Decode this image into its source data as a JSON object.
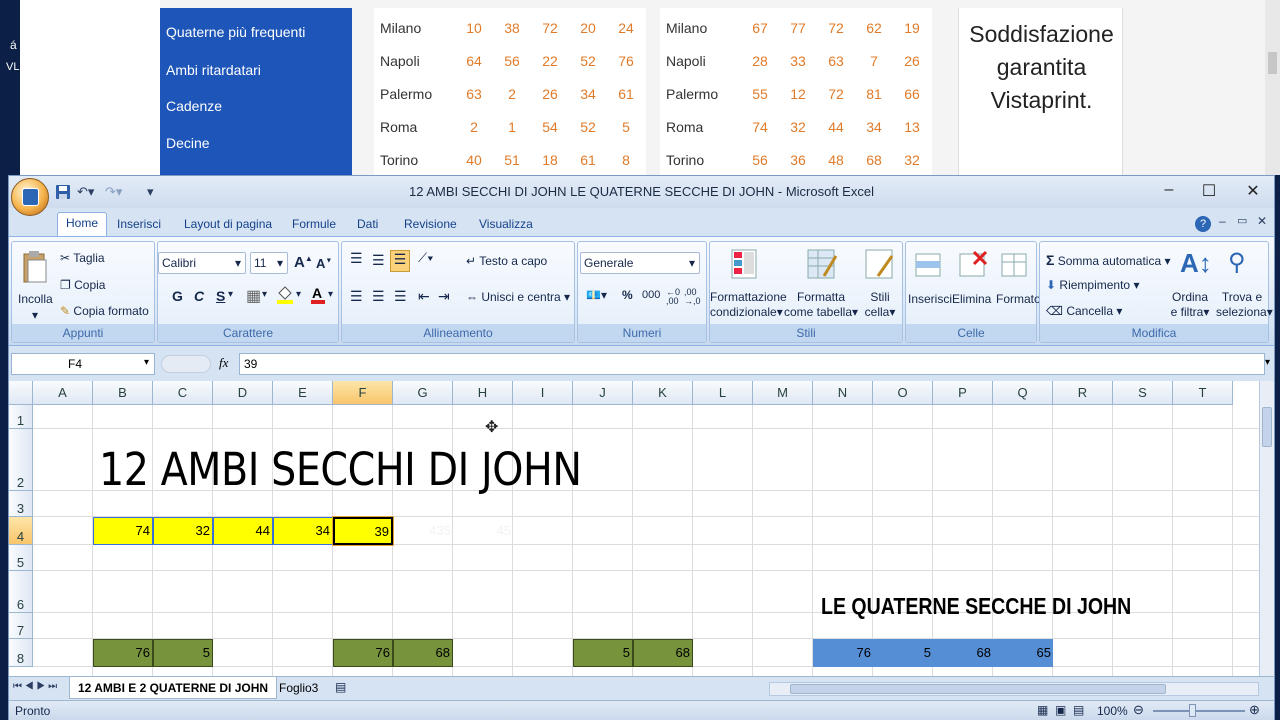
{
  "background_page": {
    "menu_items": [
      "Quaterne più frequenti",
      "Ambi ritardatari",
      "Cadenze",
      "Decine"
    ],
    "table1": [
      {
        "city": "Milano",
        "nums": [
          "10",
          "38",
          "72",
          "20",
          "24"
        ]
      },
      {
        "city": "Napoli",
        "nums": [
          "64",
          "56",
          "22",
          "52",
          "76"
        ]
      },
      {
        "city": "Palermo",
        "nums": [
          "63",
          "2",
          "26",
          "34",
          "61"
        ]
      },
      {
        "city": "Roma",
        "nums": [
          "2",
          "1",
          "54",
          "52",
          "5"
        ]
      },
      {
        "city": "Torino",
        "nums": [
          "40",
          "51",
          "18",
          "61",
          "8"
        ]
      }
    ],
    "table2": [
      {
        "city": "Milano",
        "nums": [
          "67",
          "77",
          "72",
          "62",
          "19"
        ]
      },
      {
        "city": "Napoli",
        "nums": [
          "28",
          "33",
          "63",
          "7",
          "26"
        ]
      },
      {
        "city": "Palermo",
        "nums": [
          "55",
          "12",
          "72",
          "81",
          "66"
        ]
      },
      {
        "city": "Roma",
        "nums": [
          "74",
          "32",
          "44",
          "34",
          "13"
        ]
      },
      {
        "city": "Torino",
        "nums": [
          "56",
          "36",
          "48",
          "68",
          "32"
        ]
      }
    ],
    "ad_text": [
      "Soddisfazione",
      "garantita",
      "Vistaprint."
    ],
    "side_letters": [
      "á",
      "VL"
    ]
  },
  "window": {
    "title": "12 AMBI SECCHI DI JOHN LE QUATERNE SECCHE DI JOHN - Microsoft Excel",
    "controls": [
      "–",
      "☐",
      "✕"
    ]
  },
  "tabs": [
    "Home",
    "Inserisci",
    "Layout di pagina",
    "Formule",
    "Dati",
    "Revisione",
    "Visualizza"
  ],
  "ribbon": {
    "clipboard": {
      "paste": "Incolla",
      "cut": "Taglia",
      "copy": "Copia",
      "format_painter": "Copia formato",
      "label": "Appunti"
    },
    "font": {
      "name": "Calibri",
      "size": "11",
      "bold": "G",
      "italic": "C",
      "underline": "S",
      "label": "Carattere"
    },
    "alignment": {
      "wrap": "Testo a capo",
      "merge": "Unisci e centra",
      "label": "Allineamento"
    },
    "number": {
      "format": "Generale",
      "percent": "%",
      "thousands": "000",
      "label": "Numeri"
    },
    "styles": {
      "conditional": [
        "Formattazione",
        "condizionale"
      ],
      "table": [
        "Formatta",
        "come tabella"
      ],
      "cell": [
        "Stili",
        "cella"
      ],
      "label": "Stili"
    },
    "cells": {
      "insert": "Inserisci",
      "delete": "Elimina",
      "format": "Formato",
      "label": "Celle"
    },
    "editing": {
      "autosum": "Somma automatica",
      "fill": "Riempimento",
      "clear": "Cancella",
      "sort": [
        "Ordina",
        "e filtra"
      ],
      "find": [
        "Trova e",
        "seleziona"
      ],
      "label": "Modifica"
    }
  },
  "formula_bar": {
    "name_box": "F4",
    "fx": "fx",
    "content": "39"
  },
  "columns": [
    "A",
    "B",
    "C",
    "D",
    "E",
    "F",
    "G",
    "H",
    "I",
    "J",
    "K",
    "L",
    "M",
    "N",
    "O",
    "P",
    "Q",
    "R",
    "S",
    "T"
  ],
  "rows": [
    "1",
    "2",
    "3",
    "4",
    "5",
    "6",
    "7",
    "8"
  ],
  "sheet": {
    "title": "12 AMBI SECCHI DI JOHN",
    "subtitle": "LE QUATERNE SECCHE DI JOHN",
    "row4": [
      "74",
      "32",
      "44",
      "34",
      "39"
    ],
    "row4_faint": [
      "435",
      "45"
    ],
    "row8_green": [
      "76",
      "5",
      "76",
      "68",
      "5",
      "68"
    ],
    "row8_blue": [
      "76",
      "5",
      "68",
      "65"
    ],
    "colors": {
      "yellow": "#ffff00",
      "green": "#77933c",
      "blue": "#558ed5"
    }
  },
  "sheet_tabs": [
    "12 AMBI E 2 QUATERNE DI JOHN",
    "Foglio3"
  ],
  "status": {
    "ready": "Pronto",
    "zoom": "100%"
  }
}
